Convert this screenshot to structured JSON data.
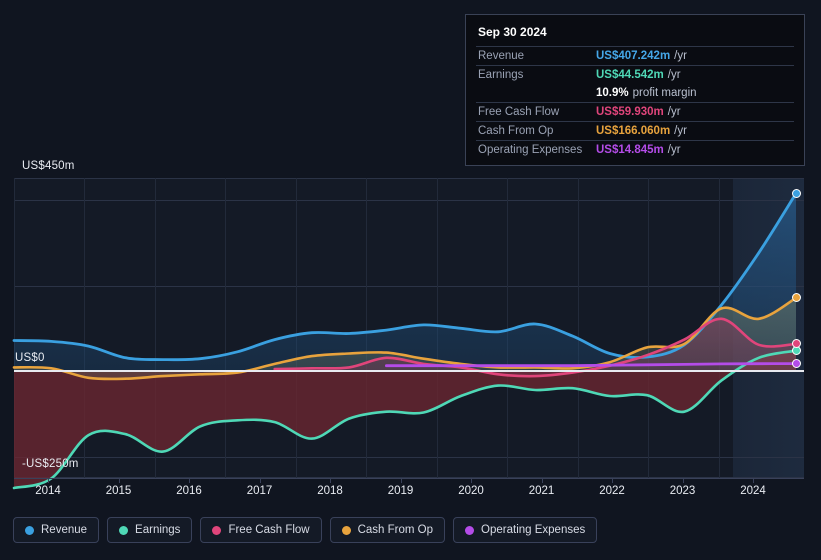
{
  "tooltip": {
    "date": "Sep 30 2024",
    "rows": [
      {
        "key": "Revenue",
        "value": "US$407.242m",
        "unit": "/yr",
        "color": "#45a7e8"
      },
      {
        "key": "Earnings",
        "value": "US$44.542m",
        "unit": "/yr",
        "color": "#4fd8b6"
      },
      {
        "key": "",
        "value": "10.9%",
        "unit": "profit margin",
        "color": "#ffffff"
      },
      {
        "key": "Free Cash Flow",
        "value": "US$59.930m",
        "unit": "/yr",
        "color": "#e0457b"
      },
      {
        "key": "Cash From Op",
        "value": "US$166.060m",
        "unit": "/yr",
        "color": "#e8a33d"
      },
      {
        "key": "Operating Expenses",
        "value": "US$14.845m",
        "unit": "/yr",
        "color": "#b44ce8"
      }
    ]
  },
  "axis": {
    "y_top_label": "US$450m",
    "y_zero_label": "US$0",
    "y_bottom_label": "-US$250m",
    "x_labels": [
      "2014",
      "2015",
      "2016",
      "2017",
      "2018",
      "2019",
      "2020",
      "2021",
      "2022",
      "2023",
      "2024"
    ]
  },
  "legend": [
    {
      "label": "Revenue",
      "color": "#3aa0e0"
    },
    {
      "label": "Earnings",
      "color": "#4fd8b6"
    },
    {
      "label": "Free Cash Flow",
      "color": "#e0457b"
    },
    {
      "label": "Cash From Op",
      "color": "#e8a33d"
    },
    {
      "label": "Operating Expenses",
      "color": "#b44ce8"
    }
  ],
  "chart_data": {
    "type": "area",
    "title": "",
    "xlabel": "",
    "ylabel": "US$m",
    "ylim": [
      -280,
      450
    ],
    "grid": true,
    "legend_position": "bottom",
    "x": [
      "2014",
      "2014.5",
      "2015",
      "2015.5",
      "2016",
      "2016.5",
      "2017",
      "2017.5",
      "2018",
      "2018.5",
      "2019",
      "2019.5",
      "2020",
      "2020.5",
      "2021",
      "2021.5",
      "2022",
      "2022.5",
      "2023",
      "2023.5",
      "2024",
      "2024.75"
    ],
    "series": [
      {
        "name": "Revenue",
        "color": "#3aa0e0",
        "values": [
          68,
          66,
          55,
          28,
          24,
          26,
          42,
          70,
          86,
          84,
          92,
          104,
          96,
          88,
          106,
          78,
          38,
          30,
          58,
          150,
          270,
          407
        ]
      },
      {
        "name": "Earnings",
        "color": "#4fd8b6",
        "values": [
          -272,
          -250,
          -150,
          -148,
          -188,
          -130,
          -116,
          -120,
          -158,
          -112,
          -96,
          -98,
          -60,
          -36,
          -46,
          -42,
          -60,
          -58,
          -96,
          -24,
          28,
          44.5
        ]
      },
      {
        "name": "Free Cash Flow",
        "color": "#e0457b",
        "values": [
          null,
          null,
          null,
          null,
          null,
          null,
          null,
          2,
          4,
          6,
          28,
          14,
          6,
          -10,
          -14,
          -6,
          10,
          34,
          70,
          118,
          58,
          60
        ]
      },
      {
        "name": "Cash From Op",
        "color": "#e8a33d",
        "values": [
          6,
          4,
          -18,
          -20,
          -14,
          -10,
          -6,
          14,
          32,
          38,
          40,
          26,
          14,
          6,
          6,
          4,
          18,
          52,
          60,
          142,
          118,
          166
        ]
      },
      {
        "name": "Operating Expenses",
        "color": "#b44ce8",
        "values": [
          null,
          null,
          null,
          null,
          null,
          null,
          null,
          null,
          null,
          null,
          10,
          10,
          10,
          10,
          10,
          10,
          11,
          12,
          13,
          14,
          14.5,
          14.8
        ]
      }
    ],
    "forecast_start": "2023.9"
  }
}
